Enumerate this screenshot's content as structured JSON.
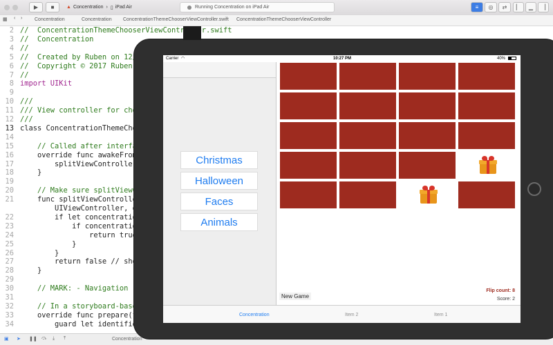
{
  "xcode": {
    "scheme_app": "Concentration",
    "scheme_device": "iPad Air",
    "status": "Running Concentration on iPad Air",
    "jumpbar": [
      "Concentration",
      "Concentration",
      "ConcentrationThemeChooserViewController.swift",
      "ConcentrationThemeChooserViewController"
    ],
    "bottom_label": "Concentration",
    "code_lines": [
      {
        "n": "2",
        "t": "//  ConcentrationThemeChooserViewController.swift",
        "k": "comment"
      },
      {
        "n": "3",
        "t": "//  Concentration",
        "k": "comment"
      },
      {
        "n": "4",
        "t": "//",
        "k": "comment"
      },
      {
        "n": "5",
        "t": "//  Created by Ruben on 12/",
        "k": "comment"
      },
      {
        "n": "6",
        "t": "//  Copyright © 2017 Ruben.",
        "k": "comment"
      },
      {
        "n": "7",
        "t": "//",
        "k": "comment"
      },
      {
        "n": "8",
        "t": "import UIKit",
        "k": "kw"
      },
      {
        "n": "9",
        "t": "",
        "k": "plain"
      },
      {
        "n": "10",
        "t": "///",
        "k": "comment"
      },
      {
        "n": "11",
        "t": "/// View controller for choo",
        "k": "comment"
      },
      {
        "n": "12",
        "t": "///",
        "k": "comment"
      },
      {
        "n": "13",
        "t": "class ConcentrationThemeChoo",
        "k": "plain"
      },
      {
        "n": "14",
        "t": "",
        "k": "plain"
      },
      {
        "n": "15",
        "t": "    // Called after interfac",
        "k": "comment"
      },
      {
        "n": "16",
        "t": "    override func awakeFromN",
        "k": "plain"
      },
      {
        "n": "17",
        "t": "        splitViewController?",
        "k": "plain"
      },
      {
        "n": "18",
        "t": "    }",
        "k": "plain"
      },
      {
        "n": "19",
        "t": "",
        "k": "plain"
      },
      {
        "n": "20",
        "t": "    // Make sure splitViewCo",
        "k": "comment"
      },
      {
        "n": "21",
        "t": "    func splitViewController",
        "k": "plain"
      },
      {
        "n": "",
        "t": "        UIViewController, on",
        "k": "plain"
      },
      {
        "n": "22",
        "t": "        if let concentration",
        "k": "plain"
      },
      {
        "n": "23",
        "t": "            if concentration",
        "k": "plain"
      },
      {
        "n": "24",
        "t": "                return true",
        "k": "plain"
      },
      {
        "n": "25",
        "t": "            }",
        "k": "plain"
      },
      {
        "n": "26",
        "t": "        }",
        "k": "plain"
      },
      {
        "n": "27",
        "t": "        return false // show",
        "k": "plain"
      },
      {
        "n": "28",
        "t": "    }",
        "k": "plain"
      },
      {
        "n": "29",
        "t": "",
        "k": "plain"
      },
      {
        "n": "30",
        "t": "    // MARK: - Navigation",
        "k": "comment"
      },
      {
        "n": "31",
        "t": "",
        "k": "plain"
      },
      {
        "n": "32",
        "t": "    // In a storyboard-based",
        "k": "comment"
      },
      {
        "n": "33",
        "t": "    override func prepare(fo",
        "k": "plain"
      },
      {
        "n": "34",
        "t": "        guard let identifier",
        "k": "plain"
      }
    ]
  },
  "simulator": {
    "carrier": "Carrier",
    "time": "10:27 PM",
    "battery": "40%",
    "themes": [
      "Christmas",
      "Halloween",
      "Faces",
      "Animals"
    ],
    "card_grid": [
      [
        "down",
        "down",
        "down",
        "down"
      ],
      [
        "down",
        "down",
        "down",
        "down"
      ],
      [
        "down",
        "down",
        "down",
        "down"
      ],
      [
        "down",
        "down",
        "down",
        "gift"
      ],
      [
        "down",
        "down",
        "gift",
        "down"
      ]
    ],
    "new_game": "New Game",
    "flip_count": "Flip count: 8",
    "score": "Score: 2",
    "tabs": [
      "Concentration",
      "Item 2",
      "Item 1"
    ],
    "colors": {
      "card_back": "#9e2b1f",
      "tint": "#1e7cf0"
    }
  }
}
